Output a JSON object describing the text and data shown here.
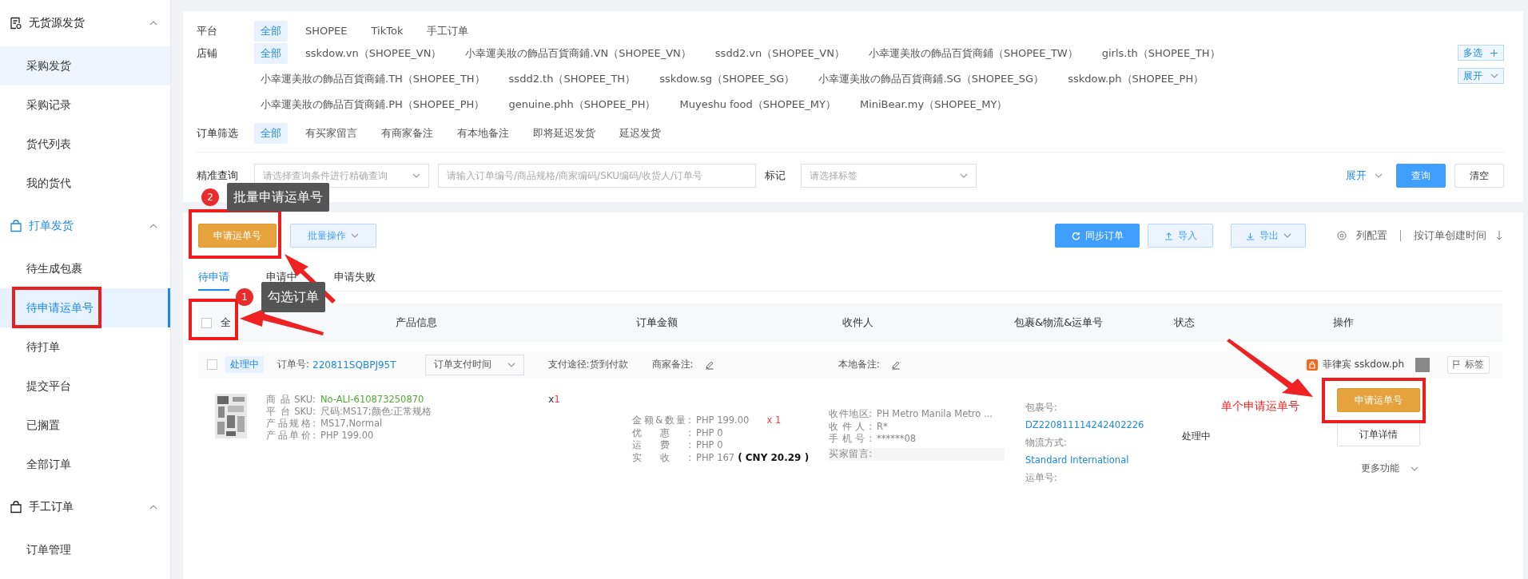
{
  "sidebar": {
    "groups": [
      {
        "title": "无货源发货",
        "active": false,
        "expanded": true,
        "items": [
          {
            "label": "采购发货",
            "selected": false,
            "hovered": true
          },
          {
            "label": "采购记录",
            "selected": false,
            "hovered": false
          },
          {
            "label": "货代列表",
            "selected": false,
            "hovered": false
          },
          {
            "label": "我的货代",
            "selected": false,
            "hovered": false
          }
        ]
      },
      {
        "title": "打单发货",
        "active": true,
        "expanded": true,
        "items": [
          {
            "label": "待生成包裹",
            "selected": false,
            "hovered": false
          },
          {
            "label": "待申请运单号",
            "selected": true,
            "hovered": false
          },
          {
            "label": "待打单",
            "selected": false,
            "hovered": false
          },
          {
            "label": "提交平台",
            "selected": false,
            "hovered": false
          },
          {
            "label": "已搁置",
            "selected": false,
            "hovered": false
          },
          {
            "label": "全部订单",
            "selected": false,
            "hovered": false
          }
        ]
      },
      {
        "title": "手工订单",
        "active": false,
        "expanded": true,
        "items": [
          {
            "label": "订单管理",
            "selected": false,
            "hovered": false
          }
        ]
      }
    ]
  },
  "filters": {
    "platform": {
      "label": "平台",
      "options": [
        {
          "label": "全部",
          "selected": true
        },
        {
          "label": "SHOPEE",
          "selected": false
        },
        {
          "label": "TikTok",
          "selected": false
        },
        {
          "label": "手工订单",
          "selected": false
        }
      ]
    },
    "shop": {
      "label": "店铺",
      "multi_button": "多选",
      "expand_button": "展开",
      "options": [
        {
          "label": "全部",
          "selected": true
        },
        {
          "label": "sskdow.vn（SHOPEE_VN）",
          "selected": false
        },
        {
          "label": "小幸運美妝の飾品百貨商鋪.VN（SHOPEE_VN）",
          "selected": false
        },
        {
          "label": "ssdd2.vn（SHOPEE_VN）",
          "selected": false
        },
        {
          "label": "小幸運美妝の飾品百貨商鋪（SHOPEE_TW）",
          "selected": false
        },
        {
          "label": "girls.th（SHOPEE_TH）",
          "selected": false
        },
        {
          "label": "小幸運美妝の飾品百貨商鋪.TH（SHOPEE_TH）",
          "selected": false
        },
        {
          "label": "ssdd2.th（SHOPEE_TH）",
          "selected": false
        },
        {
          "label": "sskdow.sg（SHOPEE_SG）",
          "selected": false
        },
        {
          "label": "小幸運美妝の飾品百貨商鋪.SG（SHOPEE_SG）",
          "selected": false
        },
        {
          "label": "sskdow.ph（SHOPEE_PH）",
          "selected": false
        },
        {
          "label": "小幸運美妝の飾品百貨商鋪.PH（SHOPEE_PH）",
          "selected": false
        },
        {
          "label": "genuine.phh（SHOPEE_PH）",
          "selected": false
        },
        {
          "label": "Muyeshu food（SHOPEE_MY）",
          "selected": false
        },
        {
          "label": "MiniBear.my（SHOPEE_MY）",
          "selected": false
        }
      ]
    },
    "order_filter": {
      "label": "订单筛选",
      "options": [
        {
          "label": "全部",
          "selected": true
        },
        {
          "label": "有买家留言",
          "selected": false
        },
        {
          "label": "有商家备注",
          "selected": false
        },
        {
          "label": "有本地备注",
          "selected": false
        },
        {
          "label": "即将延迟发货",
          "selected": false
        },
        {
          "label": "延迟发货",
          "selected": false
        }
      ]
    },
    "search": {
      "label": "精准查询",
      "condition_placeholder": "请选择查询条件进行精确查询",
      "keyword_placeholder": "请输入订单编号/商品规格/商家编码/SKU编码/收货人/订单号",
      "tag_label": "标记",
      "tag_placeholder": "请选择标签",
      "expand_link": "展开",
      "query_button": "查询",
      "clear_button": "清空"
    }
  },
  "toolbar": {
    "apply_button": "申请运单号",
    "batch_button": "批量操作",
    "sync_button": "同步订单",
    "import_button": "导入",
    "export_button": "导出",
    "column_config": "列配置",
    "sort_label": "按订单创建时间"
  },
  "tabs": [
    {
      "label": "待申请",
      "selected": true
    },
    {
      "label": "申请中",
      "selected": false
    },
    {
      "label": "申请失败",
      "selected": false
    }
  ],
  "table": {
    "select_all": {
      "label": "全",
      "checked": false
    },
    "columns": [
      "产品信息",
      "订单金额",
      "收件人",
      "包裹&物流&运单号",
      "状态",
      "操作"
    ]
  },
  "orders": [
    {
      "checked": false,
      "status_tag": "处理中",
      "order_no_label": "订单号:",
      "order_no": "220811SQBPJ95T",
      "time_select": "订单支付时间",
      "payment": "支付途径:货到付款",
      "merchant_note_label": "商家备注:",
      "local_note_label": "本地备注:",
      "shop": "菲律宾 sskdow.ph",
      "tag_button": "标签",
      "product": {
        "quantity_prefix": "x",
        "quantity": "1",
        "lines": [
          {
            "label": "商品SKU:",
            "value": "No-ALI-610873250870",
            "kind": "link"
          },
          {
            "label": "平台SKU:",
            "value": "尺码:MS17;颜色:正常规格",
            "kind": "plain"
          },
          {
            "label": "产品规格:",
            "value": "MS17,Normal",
            "kind": "plain"
          },
          {
            "label": "产品单价:",
            "value": "PHP 199.00",
            "kind": "plain"
          }
        ]
      },
      "amount": [
        {
          "label": "金额&数量:",
          "value": "PHP 199.00",
          "extra": "x 1",
          "kind": "quantity"
        },
        {
          "label": "优惠:",
          "value": "PHP 0"
        },
        {
          "label": "运费:",
          "value": "PHP 0"
        },
        {
          "label": "实收:",
          "value": "PHP 167",
          "extra": "( CNY  20.29 )",
          "kind": "converted"
        }
      ],
      "recipient": {
        "lines": [
          {
            "label": "收件地区:",
            "value": "PH Metro Manila Metro ..."
          },
          {
            "label": "收件人:",
            "value": "R*"
          },
          {
            "label": "手机号:",
            "value": "******08"
          }
        ],
        "message_label": "买家留言:"
      },
      "package": [
        {
          "text": "包裹号:",
          "kind": "label"
        },
        {
          "text": "DZ220811114242402226",
          "kind": "link"
        },
        {
          "text": "物流方式:",
          "kind": "label"
        },
        {
          "text": "Standard International",
          "kind": "link"
        },
        {
          "text": "运单号:",
          "kind": "label"
        }
      ],
      "status": "处理中",
      "actions": {
        "apply_button": "申请运单号",
        "detail_button": "订单详情",
        "more_link": "更多功能"
      }
    }
  ],
  "annotations": {
    "callouts": [
      {
        "number": "2",
        "text": "批量申请运单号"
      },
      {
        "number": "1",
        "text": "勾选订单"
      }
    ],
    "note": "单个申请运单号"
  }
}
